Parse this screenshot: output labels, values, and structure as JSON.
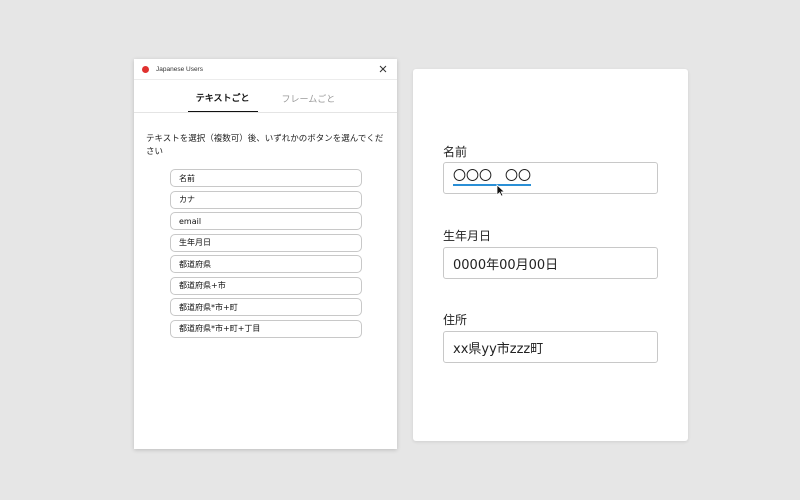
{
  "plugin": {
    "title": "Japanese Users",
    "tabs": [
      {
        "label": "テキストごと",
        "active": true
      },
      {
        "label": "フレームごと",
        "active": false
      }
    ],
    "instruction": "テキストを選択（複数可）後、いずれかのボタンを選んでください",
    "buttons": [
      "名前",
      "カナ",
      "email",
      "生年月日",
      "都道府県",
      "都道府県+市",
      "都道府県*市+町",
      "都道府県*市+町+丁目"
    ]
  },
  "form": {
    "name_label": "名前",
    "name_value": "〇〇〇　〇〇",
    "birth_label": "生年月日",
    "birth_value": "0000年00月00日",
    "address_label": "住所",
    "address_value": "xx県yy市zzz町"
  },
  "colors": {
    "brand": "#e0312f",
    "focus_underline": "#2a8fd6"
  },
  "icons": [
    "close-icon",
    "cursor-icon",
    "app-icon"
  ]
}
